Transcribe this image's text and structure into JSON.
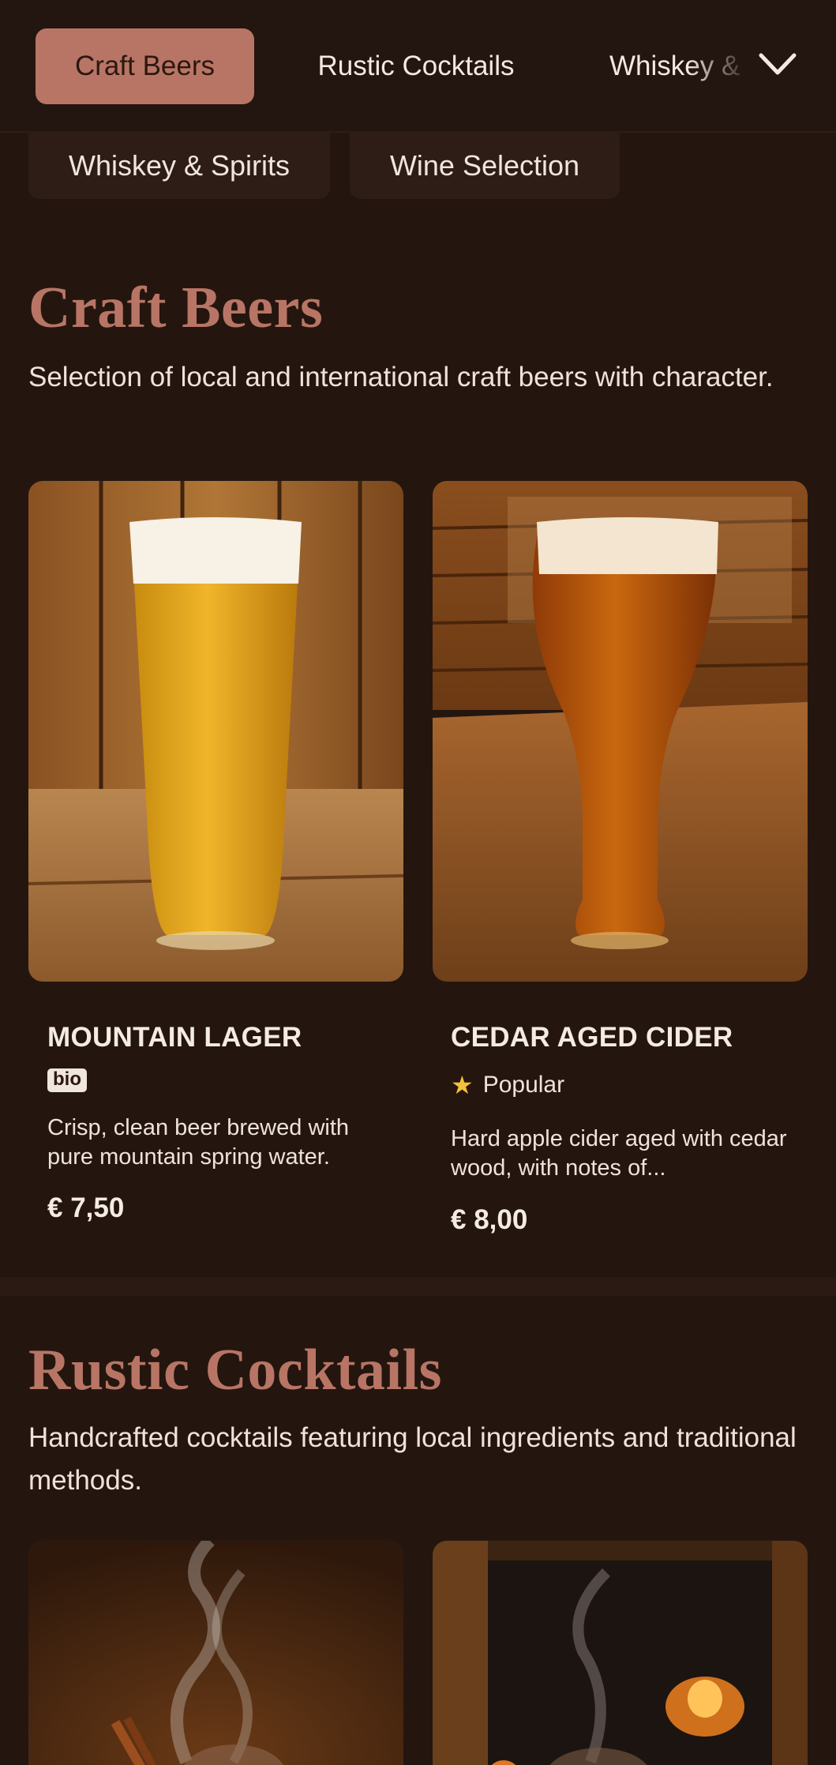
{
  "nav": {
    "tabs": [
      {
        "label": "Craft Beers"
      },
      {
        "label": "Rustic Cocktails"
      },
      {
        "label": "Whiskey & Spirits"
      }
    ],
    "dropdown_icon": "chevron-down-icon",
    "chips": [
      {
        "label": "Whiskey & Spirits"
      },
      {
        "label": "Wine Selection"
      }
    ]
  },
  "sections": [
    {
      "title": "Craft Beers",
      "description": "Selection of local and international craft beers with character.",
      "items": [
        {
          "name": "MOUNTAIN LAGER",
          "badge": "bio",
          "description": "Crisp, clean beer brewed with pure mountain spring water.",
          "price": "€ 7,50",
          "image_icon": "lager-glass-photo"
        },
        {
          "name": "CEDAR AGED CIDER",
          "popular_label": "Popular",
          "description": "Hard apple cider aged with cedar wood, with notes of...",
          "price": "€ 8,00",
          "image_icon": "cider-glass-photo"
        }
      ]
    },
    {
      "title": "Rustic Cocktails",
      "description": "Handcrafted cocktails featuring local ingredients and traditional methods.",
      "items": [
        {
          "image_icon": "steaming-cocktail-photo"
        },
        {
          "image_icon": "fireplace-cocktail-photo"
        }
      ]
    }
  ],
  "colors": {
    "background": "#24160f",
    "accent": "#b87565",
    "text": "#f1e6dd",
    "star": "#f3c23a"
  }
}
